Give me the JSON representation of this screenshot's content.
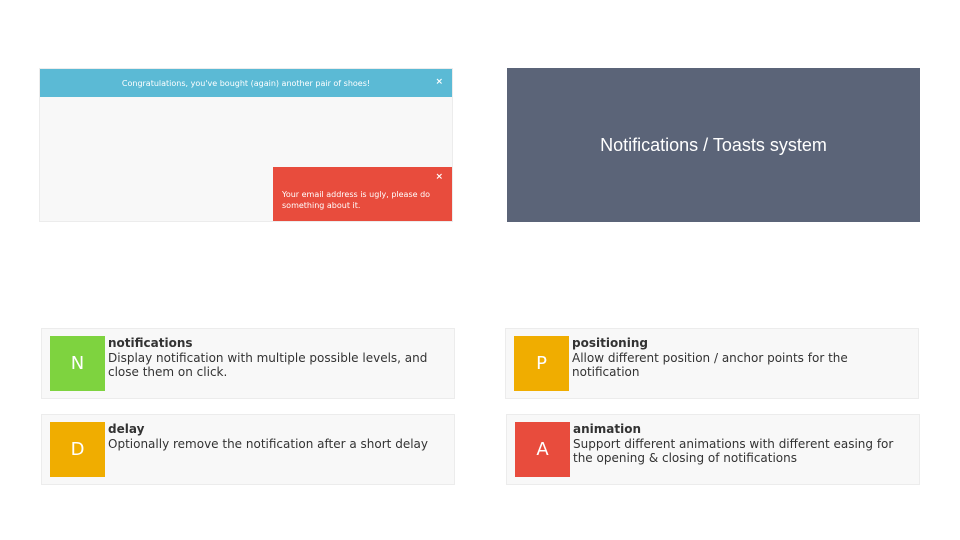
{
  "demo": {
    "top_toast": "Congratulations, you've bought (again) another pair of shoes!",
    "error_toast": "Your email address is ugly, please do something about it.",
    "close_symbol": "×"
  },
  "title": "Notifications / Toasts system",
  "features": [
    {
      "letter": "N",
      "title": "notifications",
      "description": "Display notification with multiple possible levels, and close them on click.",
      "color": "#7ed33f"
    },
    {
      "letter": "P",
      "title": "positioning",
      "description": "Allow different position / anchor points for the notification",
      "color": "#f0ad00"
    },
    {
      "letter": "D",
      "title": "delay",
      "description": "Optionally remove the notification after a short delay",
      "color": "#f0ad00"
    },
    {
      "letter": "A",
      "title": "animation",
      "description": "Support different animations with different easing for the opening & closing of notifications",
      "color": "#e84c3d"
    }
  ],
  "colors": {
    "info": "#5bbad5",
    "error": "#e84c3d",
    "title_bg": "#5b6478"
  }
}
